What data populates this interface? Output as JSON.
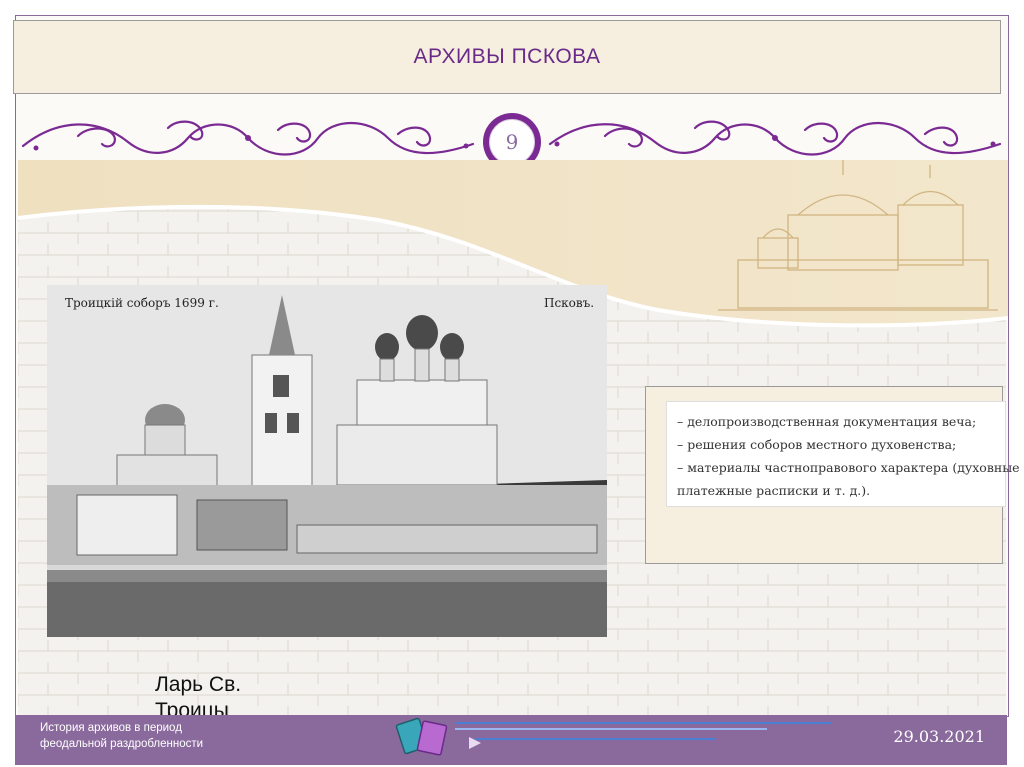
{
  "slide": {
    "title": "АРХИВЫ ПСКОВА",
    "page_number": "9",
    "accent_color": "#7a2a92",
    "footer_color": "#8a6a9c",
    "title_bg": "#f6efdf"
  },
  "photo": {
    "icon": "cathedral-photo",
    "caption_left": "Троицкій соборъ 1699 г.",
    "caption_right": "Псковъ."
  },
  "caption": {
    "line1": "Ларь Св.",
    "line2": "Троицы"
  },
  "panel": {
    "lines": [
      "– делопроизводственная документация веча;",
      "– решения соборов местного духовенства;",
      "– материалы частноправового характера (духовные",
      "платежные расписки и т. д.)."
    ]
  },
  "footer": {
    "left_line1": "История архивов в период",
    "left_line2": "феодальной раздробленности",
    "date": "29.03.2021",
    "logo_icon": "books-logo-icon"
  }
}
